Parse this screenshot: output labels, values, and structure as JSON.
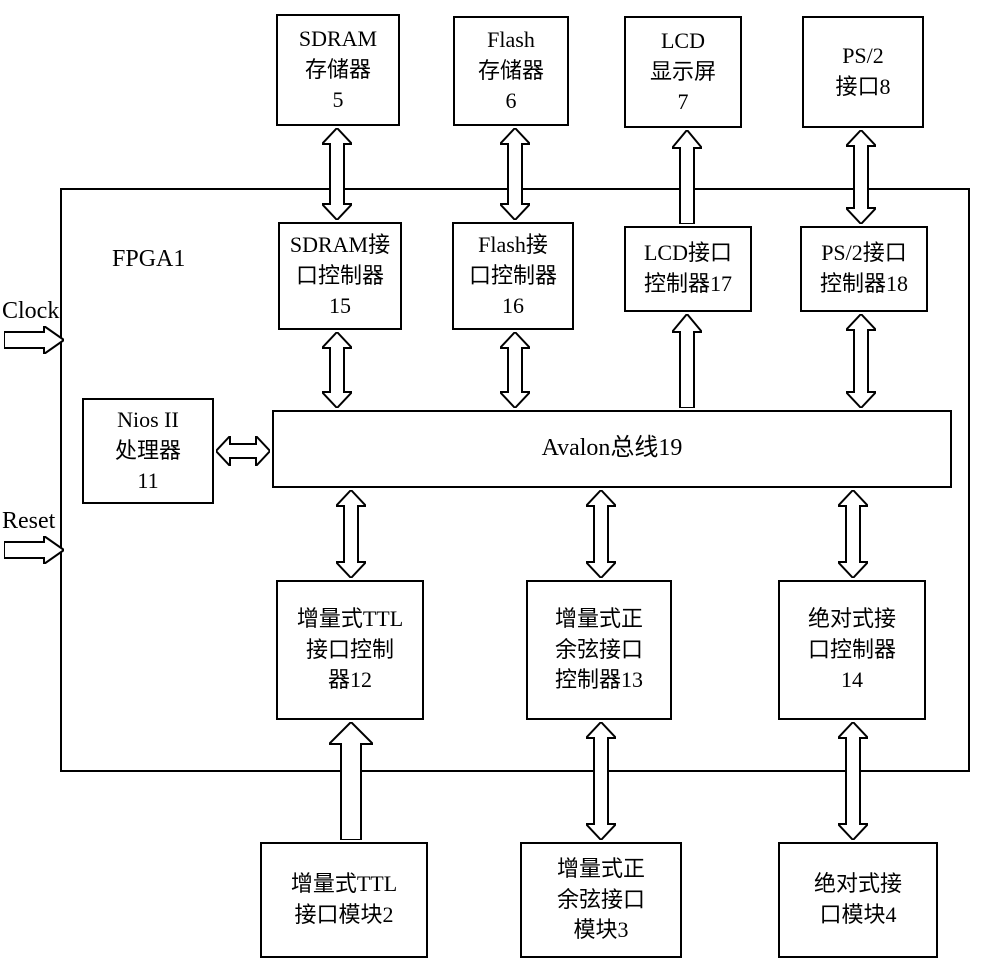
{
  "labels": {
    "fpga": "FPGA1",
    "clock": "Clock",
    "reset": "Reset"
  },
  "top_ext": {
    "sdram": "SDRAM\n存储器\n5",
    "flash": "Flash\n存储器\n6",
    "lcd": "LCD\n显示屏\n7",
    "ps2": "PS/2\n接口8"
  },
  "top_ctrl": {
    "sdram": "SDRAM接\n口控制器\n15",
    "flash": "Flash接\n口控制器\n16",
    "lcd": "LCD接口\n控制器17",
    "ps2": "PS/2接口\n控制器18"
  },
  "mid": {
    "nios": "Nios II\n处理器\n11",
    "avalon": "Avalon总线19"
  },
  "bot_ctrl": {
    "ttl": "增量式TTL\n接口控制\n器12",
    "sincos": "增量式正\n余弦接口\n控制器13",
    "abs": "绝对式接\n口控制器\n14"
  },
  "bot_ext": {
    "ttl": "增量式TTL\n接口模块2",
    "sincos": "增量式正\n余弦接口\n模块3",
    "abs": "绝对式接\n口模块4"
  }
}
